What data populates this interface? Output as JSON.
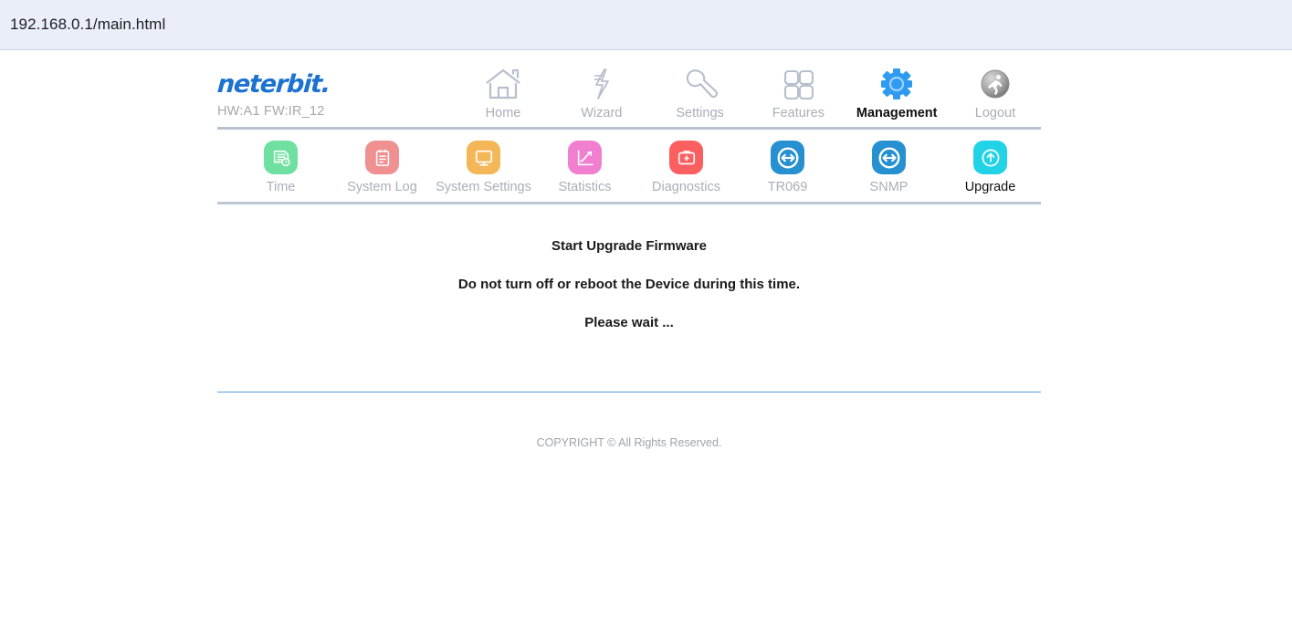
{
  "browser": {
    "url": "192.168.0.1/main.html"
  },
  "brand": {
    "logo_text": "neterbit",
    "logo_dot": ".",
    "firmware_line": "HW:A1 FW:IR_12",
    "logo_color": "#1b72d0"
  },
  "main_nav": {
    "items": [
      {
        "label": "Home",
        "icon": "home-icon",
        "active": false
      },
      {
        "label": "Wizard",
        "icon": "wizard-bolt-icon",
        "active": false
      },
      {
        "label": "Settings",
        "icon": "wrench-icon",
        "active": false
      },
      {
        "label": "Features",
        "icon": "grid-squares-icon",
        "active": false
      },
      {
        "label": "Management",
        "icon": "gear-icon",
        "active": true
      },
      {
        "label": "Logout",
        "icon": "logout-run-icon",
        "active": false
      }
    ],
    "active_color": "#2e9bf0",
    "inactive_color": "#a9aeb8"
  },
  "sub_nav": {
    "items": [
      {
        "label": "Time",
        "icon": "time-document-icon",
        "color": "#6fe0a0",
        "active": false
      },
      {
        "label": "System Log",
        "icon": "clipboard-icon",
        "color": "#f09090",
        "active": false
      },
      {
        "label": "System Settings",
        "icon": "monitor-icon",
        "color": "#f4b košt",
        "active": false
      },
      {
        "label": "Statistics",
        "icon": "chart-line-icon",
        "color": "#f07fd0",
        "active": false
      },
      {
        "label": "Diagnostics",
        "icon": "first-aid-kit-icon",
        "color": "#fb5f60",
        "active": false
      },
      {
        "label": "TR069",
        "icon": "arrows-exchange-icon",
        "color": "#2690d0",
        "active": false
      },
      {
        "label": "SNMP",
        "icon": "arrows-exchange-icon",
        "color": "#2690d0",
        "active": false
      },
      {
        "label": "Upgrade",
        "icon": "upload-arrow-icon",
        "color": "#22d3e8",
        "active": true
      }
    ]
  },
  "content": {
    "line1": "Start Upgrade Firmware",
    "line2": "Do not turn off or reboot the Device during this time.",
    "line3": "Please wait ..."
  },
  "footer": {
    "copyright": "COPYRIGHT © All Rights Reserved."
  }
}
